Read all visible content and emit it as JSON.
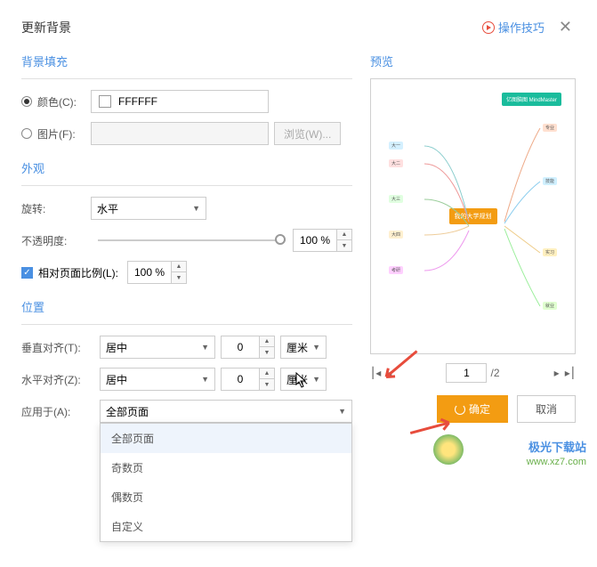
{
  "header": {
    "title": "更新背景",
    "tips": "操作技巧"
  },
  "sections": {
    "fill": "背景填充",
    "appearance": "外观",
    "position": "位置",
    "preview": "预览"
  },
  "fill": {
    "color_label": "颜色(C):",
    "color_value": "FFFFFF",
    "image_label": "图片(F):",
    "browse": "浏览(W)..."
  },
  "appearance": {
    "rotate_label": "旋转:",
    "rotate_value": "水平",
    "opacity_label": "不透明度:",
    "opacity_value": "100 %",
    "relative_label": "相对页面比例(L):",
    "relative_value": "100 %"
  },
  "position": {
    "valign_label": "垂直对齐(T):",
    "valign_value": "居中",
    "valign_offset": "0",
    "valign_unit": "厘米",
    "halign_label": "水平对齐(Z):",
    "halign_value": "居中",
    "halign_offset": "0",
    "halign_unit": "厘米",
    "apply_label": "应用于(A):",
    "apply_value": "全部页面"
  },
  "dropdown": {
    "items": [
      "全部页面",
      "奇数页",
      "偶数页",
      "自定义"
    ]
  },
  "pager": {
    "current": "1",
    "total": "/2"
  },
  "buttons": {
    "ok": "确定",
    "cancel": "取消"
  },
  "mindmap": {
    "center": "我的大学规划",
    "brand": "亿图脑图\nMindMaster"
  },
  "watermark": {
    "line1": "极光下载站",
    "line2": "www.xz7.com"
  }
}
